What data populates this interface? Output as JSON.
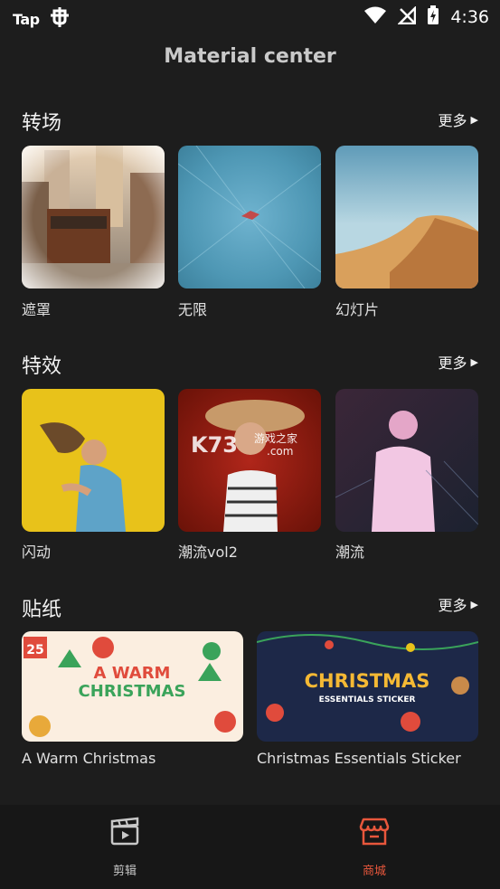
{
  "status": {
    "carrier_logo": "Tap",
    "time": "4:36"
  },
  "header": {
    "title": "Material center"
  },
  "sections": [
    {
      "title": "转场",
      "more": "更多",
      "items": [
        {
          "label": "遮罩"
        },
        {
          "label": "无限"
        },
        {
          "label": "幻灯片"
        }
      ]
    },
    {
      "title": "特效",
      "more": "更多",
      "items": [
        {
          "label": "闪动"
        },
        {
          "label": "潮流vol2"
        },
        {
          "label": "潮流"
        }
      ]
    },
    {
      "title": "贴纸",
      "more": "更多",
      "items": [
        {
          "label": "A Warm Christmas",
          "art_line1": "A WARM",
          "art_line2": "CHRISTMAS",
          "art_badge": "25"
        },
        {
          "label": "Christmas Essentials Sticker",
          "art_line1": "CHRISTMAS",
          "art_line2": "ESSENTIALS STICKER"
        }
      ]
    }
  ],
  "watermark": {
    "logo": "K73",
    "text": "游戏之家",
    "domain": ".com"
  },
  "bottom_nav": [
    {
      "label": "剪辑",
      "icon": "clapperboard-icon",
      "active": false
    },
    {
      "label": "商城",
      "icon": "store-icon",
      "active": true
    }
  ],
  "colors": {
    "background": "#1d1d1d",
    "nav_background": "#171717",
    "accent": "#e8573c",
    "inactive": "#c8c8c8"
  }
}
